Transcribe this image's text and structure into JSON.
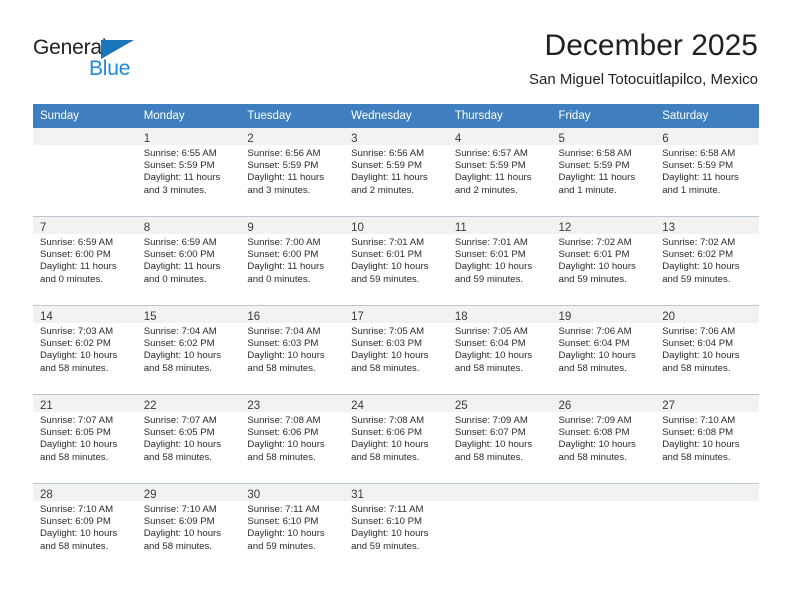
{
  "brand": {
    "name_part1": "General",
    "name_part2": "Blue",
    "accent_color": "#1b75bb",
    "blue_text_color": "#1b89e0"
  },
  "header": {
    "title": "December 2025",
    "subtitle": "San Miguel Totocuitlapilco, Mexico"
  },
  "calendar": {
    "header_bg": "#3f7fbf",
    "daynum_bg": "#f2f2f2",
    "weekday_headers": [
      "Sunday",
      "Monday",
      "Tuesday",
      "Wednesday",
      "Thursday",
      "Friday",
      "Saturday"
    ],
    "weeks": [
      [
        {
          "day": "",
          "sunrise": "",
          "sunset": "",
          "daylight": "",
          "daylight2": ""
        },
        {
          "day": "1",
          "sunrise": "Sunrise: 6:55 AM",
          "sunset": "Sunset: 5:59 PM",
          "daylight": "Daylight: 11 hours",
          "daylight2": "and 3 minutes."
        },
        {
          "day": "2",
          "sunrise": "Sunrise: 6:56 AM",
          "sunset": "Sunset: 5:59 PM",
          "daylight": "Daylight: 11 hours",
          "daylight2": "and 3 minutes."
        },
        {
          "day": "3",
          "sunrise": "Sunrise: 6:56 AM",
          "sunset": "Sunset: 5:59 PM",
          "daylight": "Daylight: 11 hours",
          "daylight2": "and 2 minutes."
        },
        {
          "day": "4",
          "sunrise": "Sunrise: 6:57 AM",
          "sunset": "Sunset: 5:59 PM",
          "daylight": "Daylight: 11 hours",
          "daylight2": "and 2 minutes."
        },
        {
          "day": "5",
          "sunrise": "Sunrise: 6:58 AM",
          "sunset": "Sunset: 5:59 PM",
          "daylight": "Daylight: 11 hours",
          "daylight2": "and 1 minute."
        },
        {
          "day": "6",
          "sunrise": "Sunrise: 6:58 AM",
          "sunset": "Sunset: 5:59 PM",
          "daylight": "Daylight: 11 hours",
          "daylight2": "and 1 minute."
        }
      ],
      [
        {
          "day": "7",
          "sunrise": "Sunrise: 6:59 AM",
          "sunset": "Sunset: 6:00 PM",
          "daylight": "Daylight: 11 hours",
          "daylight2": "and 0 minutes."
        },
        {
          "day": "8",
          "sunrise": "Sunrise: 6:59 AM",
          "sunset": "Sunset: 6:00 PM",
          "daylight": "Daylight: 11 hours",
          "daylight2": "and 0 minutes."
        },
        {
          "day": "9",
          "sunrise": "Sunrise: 7:00 AM",
          "sunset": "Sunset: 6:00 PM",
          "daylight": "Daylight: 11 hours",
          "daylight2": "and 0 minutes."
        },
        {
          "day": "10",
          "sunrise": "Sunrise: 7:01 AM",
          "sunset": "Sunset: 6:01 PM",
          "daylight": "Daylight: 10 hours",
          "daylight2": "and 59 minutes."
        },
        {
          "day": "11",
          "sunrise": "Sunrise: 7:01 AM",
          "sunset": "Sunset: 6:01 PM",
          "daylight": "Daylight: 10 hours",
          "daylight2": "and 59 minutes."
        },
        {
          "day": "12",
          "sunrise": "Sunrise: 7:02 AM",
          "sunset": "Sunset: 6:01 PM",
          "daylight": "Daylight: 10 hours",
          "daylight2": "and 59 minutes."
        },
        {
          "day": "13",
          "sunrise": "Sunrise: 7:02 AM",
          "sunset": "Sunset: 6:02 PM",
          "daylight": "Daylight: 10 hours",
          "daylight2": "and 59 minutes."
        }
      ],
      [
        {
          "day": "14",
          "sunrise": "Sunrise: 7:03 AM",
          "sunset": "Sunset: 6:02 PM",
          "daylight": "Daylight: 10 hours",
          "daylight2": "and 58 minutes."
        },
        {
          "day": "15",
          "sunrise": "Sunrise: 7:04 AM",
          "sunset": "Sunset: 6:02 PM",
          "daylight": "Daylight: 10 hours",
          "daylight2": "and 58 minutes."
        },
        {
          "day": "16",
          "sunrise": "Sunrise: 7:04 AM",
          "sunset": "Sunset: 6:03 PM",
          "daylight": "Daylight: 10 hours",
          "daylight2": "and 58 minutes."
        },
        {
          "day": "17",
          "sunrise": "Sunrise: 7:05 AM",
          "sunset": "Sunset: 6:03 PM",
          "daylight": "Daylight: 10 hours",
          "daylight2": "and 58 minutes."
        },
        {
          "day": "18",
          "sunrise": "Sunrise: 7:05 AM",
          "sunset": "Sunset: 6:04 PM",
          "daylight": "Daylight: 10 hours",
          "daylight2": "and 58 minutes."
        },
        {
          "day": "19",
          "sunrise": "Sunrise: 7:06 AM",
          "sunset": "Sunset: 6:04 PM",
          "daylight": "Daylight: 10 hours",
          "daylight2": "and 58 minutes."
        },
        {
          "day": "20",
          "sunrise": "Sunrise: 7:06 AM",
          "sunset": "Sunset: 6:04 PM",
          "daylight": "Daylight: 10 hours",
          "daylight2": "and 58 minutes."
        }
      ],
      [
        {
          "day": "21",
          "sunrise": "Sunrise: 7:07 AM",
          "sunset": "Sunset: 6:05 PM",
          "daylight": "Daylight: 10 hours",
          "daylight2": "and 58 minutes."
        },
        {
          "day": "22",
          "sunrise": "Sunrise: 7:07 AM",
          "sunset": "Sunset: 6:05 PM",
          "daylight": "Daylight: 10 hours",
          "daylight2": "and 58 minutes."
        },
        {
          "day": "23",
          "sunrise": "Sunrise: 7:08 AM",
          "sunset": "Sunset: 6:06 PM",
          "daylight": "Daylight: 10 hours",
          "daylight2": "and 58 minutes."
        },
        {
          "day": "24",
          "sunrise": "Sunrise: 7:08 AM",
          "sunset": "Sunset: 6:06 PM",
          "daylight": "Daylight: 10 hours",
          "daylight2": "and 58 minutes."
        },
        {
          "day": "25",
          "sunrise": "Sunrise: 7:09 AM",
          "sunset": "Sunset: 6:07 PM",
          "daylight": "Daylight: 10 hours",
          "daylight2": "and 58 minutes."
        },
        {
          "day": "26",
          "sunrise": "Sunrise: 7:09 AM",
          "sunset": "Sunset: 6:08 PM",
          "daylight": "Daylight: 10 hours",
          "daylight2": "and 58 minutes."
        },
        {
          "day": "27",
          "sunrise": "Sunrise: 7:10 AM",
          "sunset": "Sunset: 6:08 PM",
          "daylight": "Daylight: 10 hours",
          "daylight2": "and 58 minutes."
        }
      ],
      [
        {
          "day": "28",
          "sunrise": "Sunrise: 7:10 AM",
          "sunset": "Sunset: 6:09 PM",
          "daylight": "Daylight: 10 hours",
          "daylight2": "and 58 minutes."
        },
        {
          "day": "29",
          "sunrise": "Sunrise: 7:10 AM",
          "sunset": "Sunset: 6:09 PM",
          "daylight": "Daylight: 10 hours",
          "daylight2": "and 58 minutes."
        },
        {
          "day": "30",
          "sunrise": "Sunrise: 7:11 AM",
          "sunset": "Sunset: 6:10 PM",
          "daylight": "Daylight: 10 hours",
          "daylight2": "and 59 minutes."
        },
        {
          "day": "31",
          "sunrise": "Sunrise: 7:11 AM",
          "sunset": "Sunset: 6:10 PM",
          "daylight": "Daylight: 10 hours",
          "daylight2": "and 59 minutes."
        },
        {
          "day": "",
          "sunrise": "",
          "sunset": "",
          "daylight": "",
          "daylight2": ""
        },
        {
          "day": "",
          "sunrise": "",
          "sunset": "",
          "daylight": "",
          "daylight2": ""
        },
        {
          "day": "",
          "sunrise": "",
          "sunset": "",
          "daylight": "",
          "daylight2": ""
        }
      ]
    ]
  }
}
